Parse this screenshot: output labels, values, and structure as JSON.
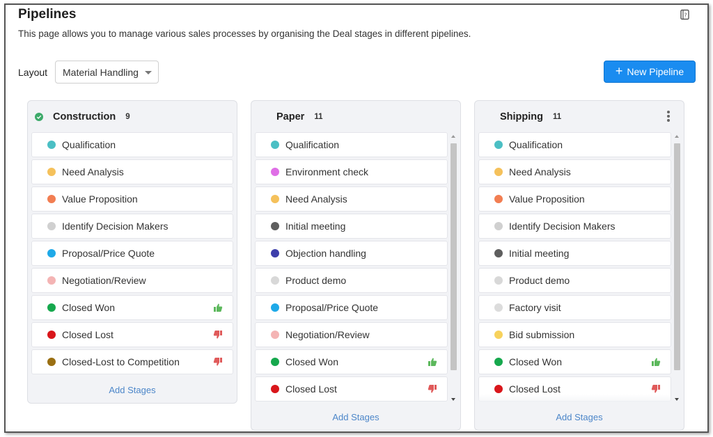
{
  "page": {
    "title": "Pipelines",
    "description": "This page allows you to manage various sales processes by organising the Deal stages in different pipelines."
  },
  "layout": {
    "label": "Layout",
    "selected": "Material Handling"
  },
  "toolbar": {
    "new_pipeline_label": "New Pipeline",
    "new_pipeline_plus": "+"
  },
  "colors": {
    "accent": "#1a8cf0",
    "won": "#5cb85c",
    "lost": "#e05a5a",
    "link": "#4c86c9"
  },
  "pipelines": [
    {
      "name": "Construction",
      "count": "9",
      "add_label": "Add Stages",
      "stages": [
        {
          "label": "Qualification",
          "color": "#4bbfc4"
        },
        {
          "label": "Need Analysis",
          "color": "#f5c15b"
        },
        {
          "label": "Value Proposition",
          "color": "#f27e52"
        },
        {
          "label": "Identify Decision Makers",
          "color": "#d0d0d0"
        },
        {
          "label": "Proposal/Price Quote",
          "color": "#1ea9e8"
        },
        {
          "label": "Negotiation/Review",
          "color": "#f4b4b4"
        },
        {
          "label": "Closed Won",
          "color": "#16a84d",
          "thumb": "up"
        },
        {
          "label": "Closed Lost",
          "color": "#d9161b",
          "thumb": "down"
        },
        {
          "label": "Closed-Lost to Competition",
          "color": "#9a6f12",
          "thumb": "down"
        }
      ]
    },
    {
      "name": "Paper",
      "count": "11",
      "add_label": "Add Stages",
      "stages": [
        {
          "label": "Qualification",
          "color": "#4bbfc4"
        },
        {
          "label": "Environment check",
          "color": "#df6fe6"
        },
        {
          "label": "Need Analysis",
          "color": "#f5c15b"
        },
        {
          "label": "Initial meeting",
          "color": "#5e5e5e"
        },
        {
          "label": "Objection handling",
          "color": "#3d3eab"
        },
        {
          "label": "Product demo",
          "color": "#d8d8d8"
        },
        {
          "label": "Proposal/Price Quote",
          "color": "#1ea9e8"
        },
        {
          "label": "Negotiation/Review",
          "color": "#f4b4b4"
        },
        {
          "label": "Closed Won",
          "color": "#16a84d",
          "thumb": "up"
        },
        {
          "label": "Closed Lost",
          "color": "#d9161b",
          "thumb": "down"
        }
      ]
    },
    {
      "name": "Shipping",
      "count": "11",
      "add_label": "Add Stages",
      "stages": [
        {
          "label": "Qualification",
          "color": "#4bbfc4"
        },
        {
          "label": "Need Analysis",
          "color": "#f5c15b"
        },
        {
          "label": "Value Proposition",
          "color": "#f27e52"
        },
        {
          "label": "Identify Decision Makers",
          "color": "#d0d0d0"
        },
        {
          "label": "Initial meeting",
          "color": "#5e5e5e"
        },
        {
          "label": "Product demo",
          "color": "#d8d8d8"
        },
        {
          "label": "Factory visit",
          "color": "#dcdcdc"
        },
        {
          "label": "Bid submission",
          "color": "#f7d25c"
        },
        {
          "label": "Closed Won",
          "color": "#16a84d",
          "thumb": "up"
        },
        {
          "label": "Closed Lost",
          "color": "#d9161b",
          "thumb": "down"
        }
      ]
    }
  ]
}
